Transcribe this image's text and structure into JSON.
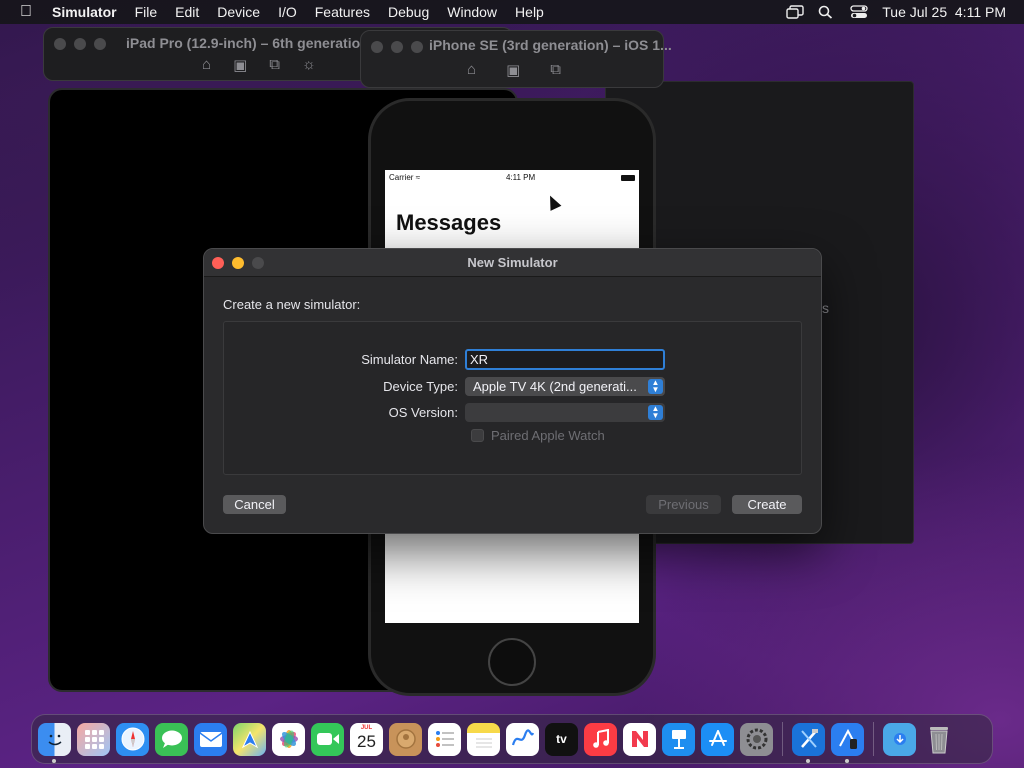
{
  "menubar": {
    "app_name": "Simulator",
    "items": [
      "File",
      "Edit",
      "Device",
      "I/O",
      "Features",
      "Debug",
      "Window",
      "Help"
    ],
    "clock": "Tue Jul 25  4:11 PM"
  },
  "windows": {
    "ipad_title": "iPad Pro (12.9-inch) – 6th generation",
    "iphone_title": "iPhone SE (3rd generation) – iOS 1...",
    "tv_partial_text": "s"
  },
  "iphone": {
    "carrier": "Carrier",
    "time": "4:11 PM",
    "screen_title": "Messages"
  },
  "dialog": {
    "title": "New Simulator",
    "subtitle": "Create a new simulator:",
    "name_label": "Simulator Name:",
    "name_value": "XR",
    "device_type_label": "Device Type:",
    "device_type_value": "Apple TV 4K (2nd generati...",
    "os_version_label": "OS Version:",
    "os_version_value": "",
    "paired_watch_label": "Paired Apple Watch",
    "paired_watch_checked": false,
    "cancel_label": "Cancel",
    "previous_label": "Previous",
    "create_label": "Create"
  },
  "dock": {
    "calendar_month": "JUL",
    "calendar_day": "25",
    "apps": [
      "finder-icon",
      "launchpad-icon",
      "safari-icon",
      "messages-icon",
      "mail-icon",
      "maps-icon",
      "photos-icon",
      "facetime-icon",
      "calendar-icon",
      "contacts-icon",
      "reminders-icon",
      "notes-icon",
      "freeform-icon",
      "tv-icon",
      "music-icon",
      "news-icon",
      "keynote-icon",
      "app-store-icon",
      "system-settings-icon",
      "xcode-icon",
      "simulator-icon",
      "downloads-folder-icon",
      "trash-icon"
    ],
    "tv_label": "tv"
  },
  "colors": {
    "accent": "#2f7fd6",
    "close": "#ff5f57",
    "minimize": "#febc2e"
  }
}
